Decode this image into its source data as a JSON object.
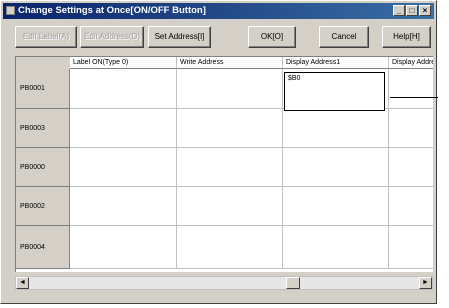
{
  "window": {
    "title": "Change Settings at Once[ON/OFF Button]",
    "controls": [
      "_",
      "□",
      "×"
    ]
  },
  "toolbar": {
    "btn1_label": "Edit Label(A)",
    "btn2_label": "Edit Address(D)",
    "set_address_label": "Set Address[I]",
    "ok_label": "OK[O]",
    "cancel_label": "Cancel",
    "help_label": "Help[H]"
  },
  "grid": {
    "columns": [
      "Label ON(Type 0)",
      "Write Address",
      "Display Address1",
      "Display Addre"
    ],
    "rows": [
      "PB0001",
      "PB0003",
      "PB0000",
      "PB0002",
      "PB0004"
    ],
    "editing_value": "$B0"
  },
  "scrollbar": {
    "left_arrow": "◄",
    "right_arrow": "►"
  }
}
